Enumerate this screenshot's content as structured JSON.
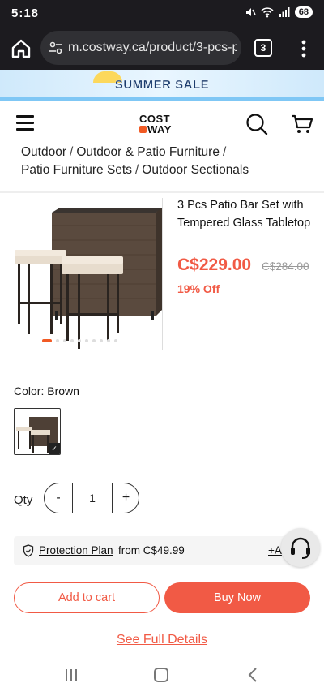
{
  "status_bar": {
    "time": "5:18",
    "battery": "68"
  },
  "browser": {
    "url": "m.costway.ca/product/3-pcs-p",
    "tab_count": "3"
  },
  "banner": {
    "text": "SUMMER SALE"
  },
  "logo": {
    "line1": "COST",
    "line2": "WAY"
  },
  "breadcrumb": {
    "items": [
      "Outdoor",
      "Outdoor & Patio Furniture",
      "Patio Furniture Sets",
      "Outdoor Sectionals"
    ],
    "separator": "/"
  },
  "product": {
    "title": "3 Pcs Patio Bar Set with Tempered Glass Tabletop",
    "price": "C$229.00",
    "old_price": "C$284.00",
    "discount": "19% Off",
    "carousel": {
      "total": 10,
      "active": 0
    }
  },
  "color": {
    "label": "Color:",
    "value": "Brown"
  },
  "qty": {
    "label": "Qty",
    "minus": "-",
    "value": "1",
    "plus": "+"
  },
  "protection": {
    "link": "Protection Plan",
    "text": "from C$49.99",
    "add": "+A"
  },
  "actions": {
    "add_to_cart": "Add to cart",
    "buy_now": "Buy Now",
    "see_details": "See Full Details"
  },
  "colors": {
    "accent": "#f15a45",
    "brand_orange": "#f15a24",
    "browser_dark": "#1c1b1f"
  }
}
